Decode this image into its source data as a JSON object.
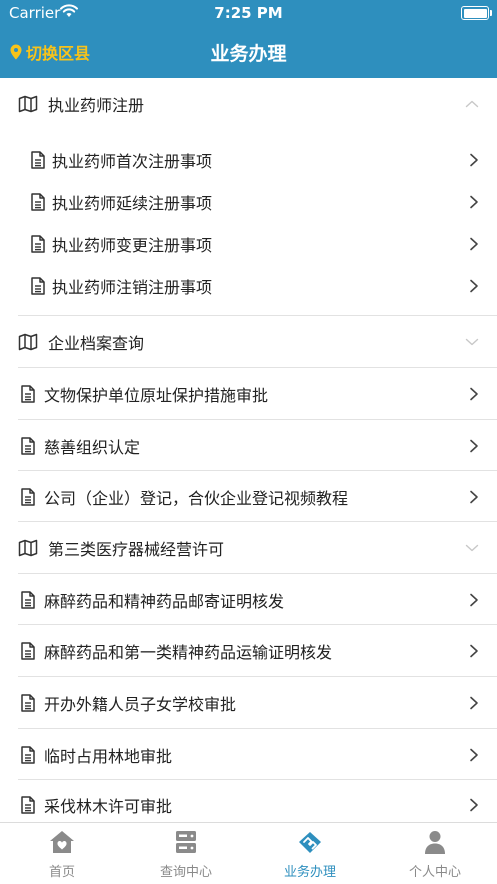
{
  "status_bar": {
    "carrier": "Carrier",
    "time": "7:25 PM"
  },
  "nav": {
    "switch_label": "切换区县",
    "title": "业务办理"
  },
  "colors": {
    "primary": "#2e8fbe",
    "accent": "#f7c31a",
    "tab_inactive": "#8a8a8a"
  },
  "list": {
    "group_pharmacist": {
      "label": "执业药师注册",
      "expanded": true,
      "icon": "map-icon",
      "children": [
        "执业药师首次注册事项",
        "执业药师延续注册事项",
        "执业药师变更注册事项",
        "执业药师注销注册事项"
      ]
    },
    "group_enterprise": {
      "label": "企业档案查询",
      "expanded": false,
      "icon": "map-icon"
    },
    "item_relic": {
      "label": "文物保护单位原址保护措施审批",
      "icon": "document-icon"
    },
    "item_charity": {
      "label": "慈善组织认定",
      "icon": "document-icon"
    },
    "item_company_video": {
      "label": "公司（企业）登记，合伙企业登记视频教程",
      "icon": "document-icon"
    },
    "group_medical_device": {
      "label": "第三类医疗器械经营许可",
      "expanded": false,
      "icon": "map-icon"
    },
    "item_anesthetic_mail": {
      "label": "麻醉药品和精神药品邮寄证明核发",
      "icon": "document-icon"
    },
    "item_anesthetic_transport": {
      "label": "麻醉药品和第一类精神药品运输证明核发",
      "icon": "document-icon"
    },
    "item_foreign_school": {
      "label": "开办外籍人员子女学校审批",
      "icon": "document-icon"
    },
    "item_forest_land": {
      "label": "临时占用林地审批",
      "icon": "document-icon"
    },
    "item_logging": {
      "label": "采伐林木许可审批",
      "icon": "document-icon"
    }
  },
  "tabs": [
    {
      "label": "首页",
      "icon": "home-icon",
      "active": false
    },
    {
      "label": "查询中心",
      "icon": "server-icon",
      "active": false
    },
    {
      "label": "业务办理",
      "icon": "handshake-icon",
      "active": true
    },
    {
      "label": "个人中心",
      "icon": "person-icon",
      "active": false
    }
  ]
}
